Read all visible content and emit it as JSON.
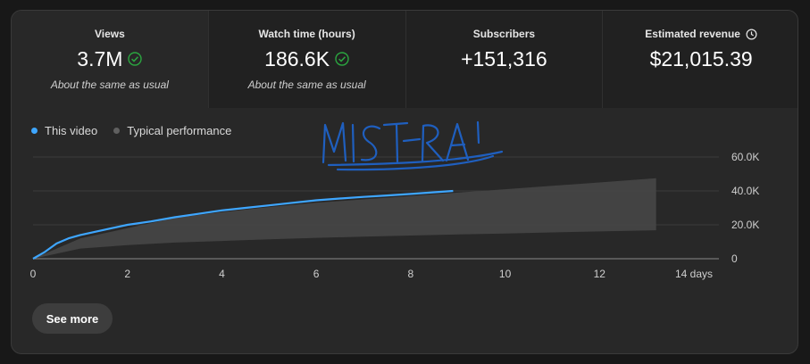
{
  "tabs": [
    {
      "label": "Views",
      "value": "3.7M",
      "note": "About the same as usual",
      "check": true
    },
    {
      "label": "Watch time (hours)",
      "value": "186.6K",
      "note": "About the same as usual",
      "check": true
    },
    {
      "label": "Subscribers",
      "value": "+151,316",
      "note": "",
      "check": false
    },
    {
      "label": "Estimated revenue",
      "value": "$21,015.39",
      "note": "",
      "check": false,
      "icon": "clock-icon"
    }
  ],
  "legend": {
    "this_video": "This video",
    "typical": "Typical performance"
  },
  "colors": {
    "accent": "#3ea6ff",
    "check": "#2ba640",
    "typical_dot": "#606060",
    "band": "#454545"
  },
  "annotation_text": "MISTRAI",
  "see_more_label": "See more",
  "chart_data": {
    "type": "line",
    "x_unit": "days",
    "xlim": [
      0,
      14
    ],
    "ylim": [
      0,
      60000
    ],
    "x_ticks": [
      "0",
      "2",
      "4",
      "6",
      "8",
      "10",
      "12",
      "14 days"
    ],
    "x_tick_values": [
      0,
      2,
      4,
      6,
      8,
      10,
      12,
      14
    ],
    "y_ticks": [
      "0",
      "20.0K",
      "40.0K",
      "60.0K"
    ],
    "y_tick_values": [
      0,
      20000,
      40000,
      60000
    ],
    "grid": true,
    "legend_position": "top-left",
    "series": [
      {
        "name": "This video",
        "x": [
          0,
          0.25,
          0.5,
          0.75,
          1,
          1.5,
          2,
          2.5,
          3,
          3.5,
          4,
          4.5,
          5,
          5.5,
          6,
          6.5,
          7,
          7.5,
          8,
          8.5,
          8.9
        ],
        "y": [
          0,
          4000,
          9000,
          12000,
          14000,
          17000,
          20000,
          22000,
          24500,
          26500,
          28500,
          30000,
          31500,
          33000,
          34500,
          35500,
          36500,
          37300,
          38200,
          39200,
          40000
        ]
      }
    ],
    "band": {
      "name": "Typical performance",
      "x": [
        0,
        1,
        2,
        3,
        4,
        5,
        6,
        7,
        8,
        9,
        10,
        11,
        12,
        13.2
      ],
      "upper": [
        0,
        12000,
        18000,
        24000,
        27500,
        30500,
        33000,
        35000,
        37000,
        39000,
        41000,
        43000,
        45000,
        47500
      ],
      "lower": [
        0,
        6000,
        8000,
        9500,
        10500,
        11500,
        12300,
        13000,
        13700,
        14300,
        14900,
        15500,
        16100,
        16800
      ]
    }
  }
}
